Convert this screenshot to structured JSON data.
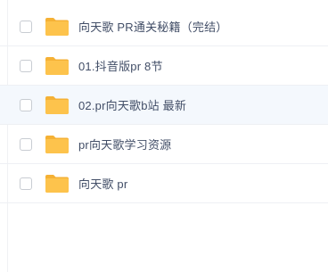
{
  "files": [
    {
      "name": "向天歌 PR通关秘籍（完结）",
      "icon": "folder-icon"
    },
    {
      "name": "01.抖音版pr 8节",
      "icon": "folder-icon"
    },
    {
      "name": "02.pr向天歌b站 最新",
      "icon": "folder-icon"
    },
    {
      "name": "pr向天歌学习资源",
      "icon": "folder-icon"
    },
    {
      "name": "向天歌 pr",
      "icon": "folder-icon"
    }
  ],
  "colors": {
    "folder": "#fdc34c",
    "folder_tab": "#f5b135",
    "highlight_row": "#f4f8fd",
    "text": "#424e67"
  }
}
